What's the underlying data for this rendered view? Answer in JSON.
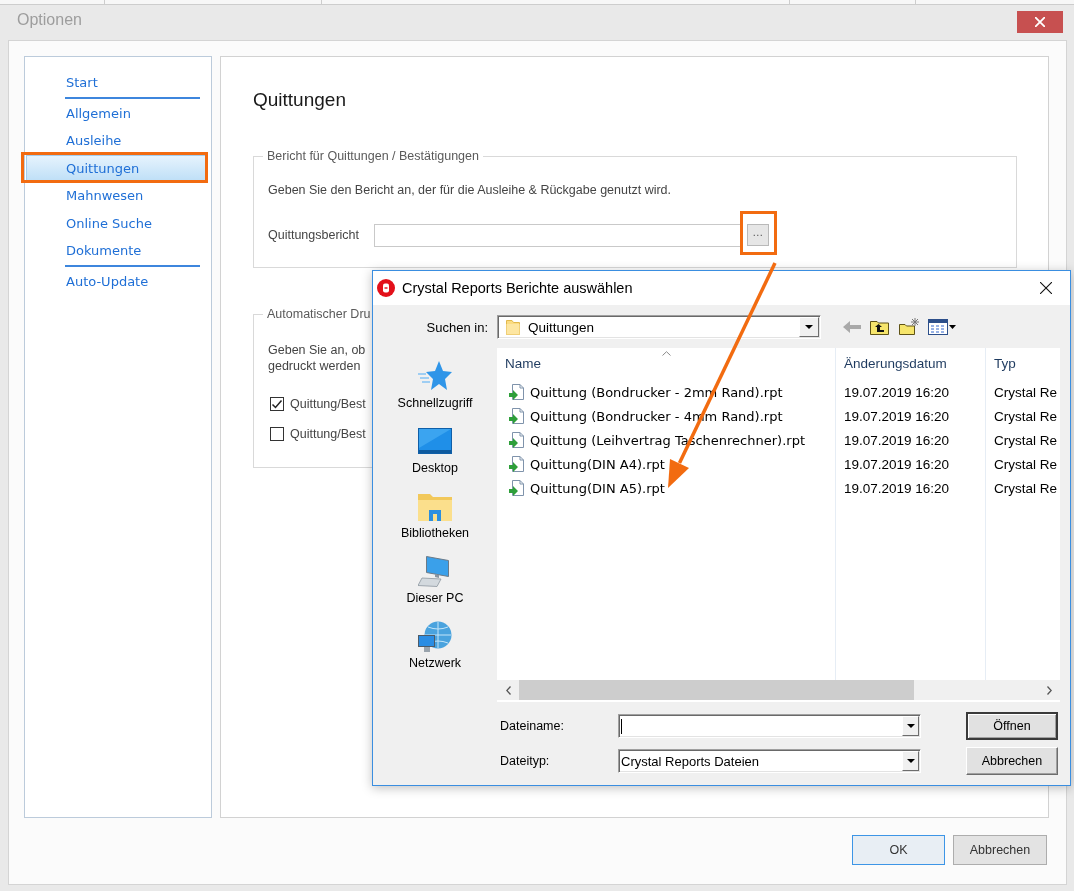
{
  "window": {
    "title": "Optionen"
  },
  "sidebar": {
    "groups": [
      {
        "items": [
          {
            "label": "Start",
            "selected": false,
            "highlighted": false
          }
        ]
      },
      {
        "items": [
          {
            "label": "Allgemein",
            "selected": false,
            "highlighted": false
          },
          {
            "label": "Ausleihe",
            "selected": false,
            "highlighted": false
          },
          {
            "label": "Quittungen",
            "selected": true,
            "highlighted": true
          },
          {
            "label": "Mahnwesen",
            "selected": false,
            "highlighted": false
          },
          {
            "label": "Online Suche",
            "selected": false,
            "highlighted": false
          },
          {
            "label": "Dokumente",
            "selected": false,
            "highlighted": false
          }
        ]
      },
      {
        "items": [
          {
            "label": "Auto-Update",
            "selected": false,
            "highlighted": false
          }
        ]
      }
    ]
  },
  "page": {
    "heading": "Quittungen",
    "report_group": {
      "legend": "Bericht für Quittungen / Bestätigungen",
      "description": "Geben Sie den Bericht an, der für die Ausleihe & Rückgabe genutzt wird.",
      "field": {
        "label": "Quittungsbericht"
      },
      "browse_button": {
        "label": "...",
        "highlighted": true
      }
    },
    "print_group": {
      "legend": "Automatischer Dru",
      "description_lines": [
        "Geben Sie an, ob",
        "gedruckt werden"
      ],
      "checkboxes": [
        {
          "label": "Quittung/Best",
          "checked": true
        },
        {
          "label": "Quittung/Best",
          "checked": false
        }
      ]
    }
  },
  "buttons": [
    {
      "label": "OK",
      "default": true
    },
    {
      "label": "Abbrechen",
      "default": false
    }
  ],
  "dialog": {
    "title": "Crystal Reports Berichte auswählen",
    "look_in": {
      "label": "Suchen in:",
      "value": "Quittungen"
    },
    "places": [
      {
        "label": "Schnellzugriff",
        "kind": "quickaccess"
      },
      {
        "label": "Desktop",
        "kind": "desktop"
      },
      {
        "label": "Bibliotheken",
        "kind": "libraries"
      },
      {
        "label": "Dieser PC",
        "kind": "computer"
      },
      {
        "label": "Netzwerk",
        "kind": "network"
      }
    ],
    "file_list": {
      "columns": [
        {
          "label": "Name",
          "sorted": true
        },
        {
          "label": "Änderungsdatum",
          "sorted": false
        },
        {
          "label": "Typ",
          "sorted": false
        }
      ],
      "rows": [
        {
          "name": "Quittung (Bondrucker - 2mm Rand).rpt",
          "date": "19.07.2019 16:20",
          "type": "Crystal Re"
        },
        {
          "name": "Quittung (Bondrucker - 4mm Rand).rpt",
          "date": "19.07.2019 16:20",
          "type": "Crystal Re"
        },
        {
          "name": "Quittung (Leihvertrag Taschenrechner).rpt",
          "date": "19.07.2019 16:20",
          "type": "Crystal Re"
        },
        {
          "name": "Quittung(DIN A4).rpt",
          "date": "19.07.2019 16:20",
          "type": "Crystal Re"
        },
        {
          "name": "Quittung(DIN A5).rpt",
          "date": "19.07.2019 16:20",
          "type": "Crystal Re"
        }
      ]
    },
    "file_name": {
      "label": "Dateiname:",
      "focused": true
    },
    "file_type": {
      "label": "Dateityp:",
      "value": "Crystal Reports Dateien"
    },
    "buttons": [
      {
        "label": "Öffnen",
        "default": true
      },
      {
        "label": "Abbrechen",
        "default": false
      }
    ]
  }
}
